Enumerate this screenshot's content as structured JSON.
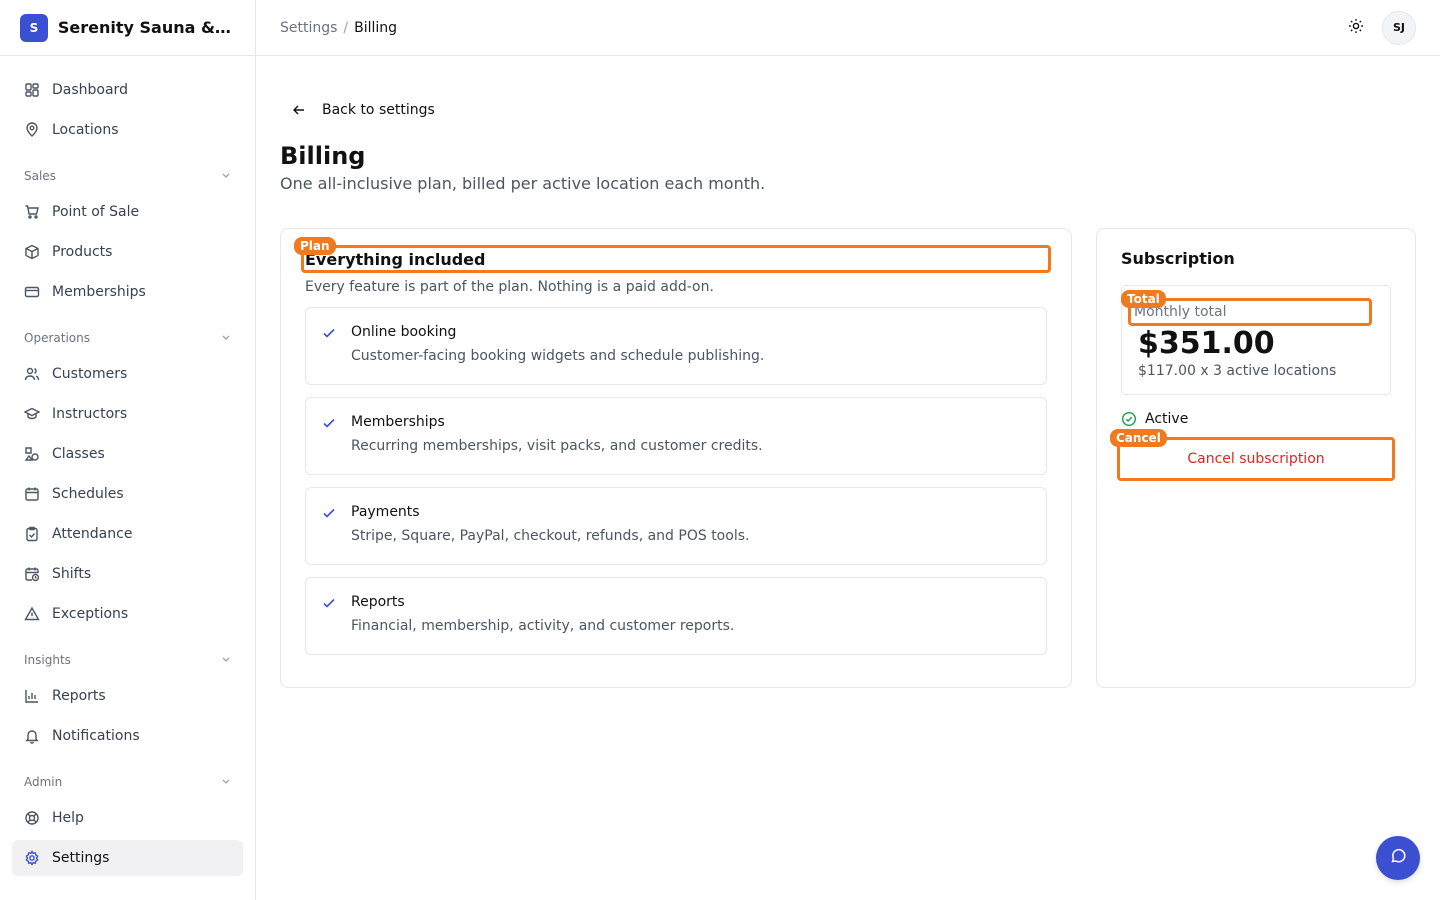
{
  "brand": {
    "logo_letter": "S",
    "name": "Serenity Sauna & Spa"
  },
  "sidebar": {
    "top_items": [
      {
        "label": "Dashboard",
        "icon": "dashboard-icon"
      },
      {
        "label": "Locations",
        "icon": "map-pin-icon"
      }
    ],
    "groups": [
      {
        "label": "Sales",
        "items": [
          {
            "label": "Point of Sale",
            "icon": "cart-icon"
          },
          {
            "label": "Products",
            "icon": "box-icon"
          },
          {
            "label": "Memberships",
            "icon": "card-icon"
          }
        ]
      },
      {
        "label": "Operations",
        "items": [
          {
            "label": "Customers",
            "icon": "users-icon"
          },
          {
            "label": "Instructors",
            "icon": "graduation-cap-icon"
          },
          {
            "label": "Classes",
            "icon": "shapes-icon"
          },
          {
            "label": "Schedules",
            "icon": "calendar-icon"
          },
          {
            "label": "Attendance",
            "icon": "clipboard-check-icon"
          },
          {
            "label": "Shifts",
            "icon": "calendar-clock-icon"
          },
          {
            "label": "Exceptions",
            "icon": "warning-icon"
          }
        ]
      },
      {
        "label": "Insights",
        "items": [
          {
            "label": "Reports",
            "icon": "bar-chart-icon"
          },
          {
            "label": "Notifications",
            "icon": "bell-icon"
          }
        ]
      },
      {
        "label": "Admin",
        "items": [
          {
            "label": "Help",
            "icon": "lifebuoy-icon"
          },
          {
            "label": "Settings",
            "icon": "gear-icon",
            "active": true
          }
        ]
      }
    ]
  },
  "header": {
    "breadcrumb": {
      "parent": "Settings",
      "separator": "/",
      "current": "Billing"
    },
    "avatar_initials": "SJ"
  },
  "main": {
    "back_label": "Back to settings",
    "title": "Billing",
    "subtitle": "One all-inclusive plan, billed per active location each month.",
    "plan": {
      "tag": "Plan",
      "title": "Everything included",
      "subtitle": "Every feature is part of the plan. Nothing is a paid add-on.",
      "features": [
        {
          "name": "Online booking",
          "desc": "Customer-facing booking widgets and schedule publishing."
        },
        {
          "name": "Memberships",
          "desc": "Recurring memberships, visit packs, and customer credits."
        },
        {
          "name": "Payments",
          "desc": "Stripe, Square, PayPal, checkout, refunds, and POS tools."
        },
        {
          "name": "Reports",
          "desc": "Financial, membership, activity, and customer reports."
        }
      ]
    },
    "subscription": {
      "title": "Subscription",
      "total_tag": "Total",
      "total_label": "Monthly total",
      "total_amount": "$351.00",
      "total_detail": "$117.00 x 3 active locations",
      "status": "Active",
      "cancel_tag": "Cancel",
      "cancel_label": "Cancel subscription"
    }
  },
  "colors": {
    "accent": "#3b4fd1",
    "highlight": "#f07a1f",
    "danger": "#dc2626",
    "success": "#16a34a"
  }
}
